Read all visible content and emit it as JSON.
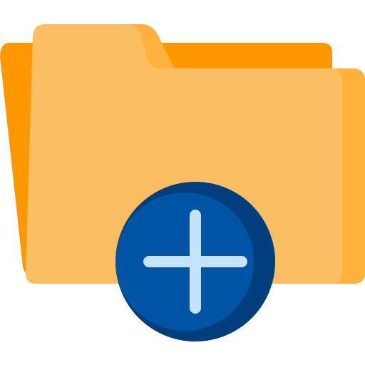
{
  "icon": {
    "name": "new-folder-icon",
    "parts": [
      "folder-back",
      "folder-tab",
      "folder-front",
      "add-badge",
      "plus-sign"
    ]
  },
  "colors": {
    "folder_back": "#FF9800",
    "folder_tab": "#FFB13D",
    "folder_front": "#FBBE62",
    "folder_front_shade": "#FFB13D",
    "badge": "#0054A6",
    "badge_shade": "#003E7E",
    "plus": "#C5E2FF"
  }
}
